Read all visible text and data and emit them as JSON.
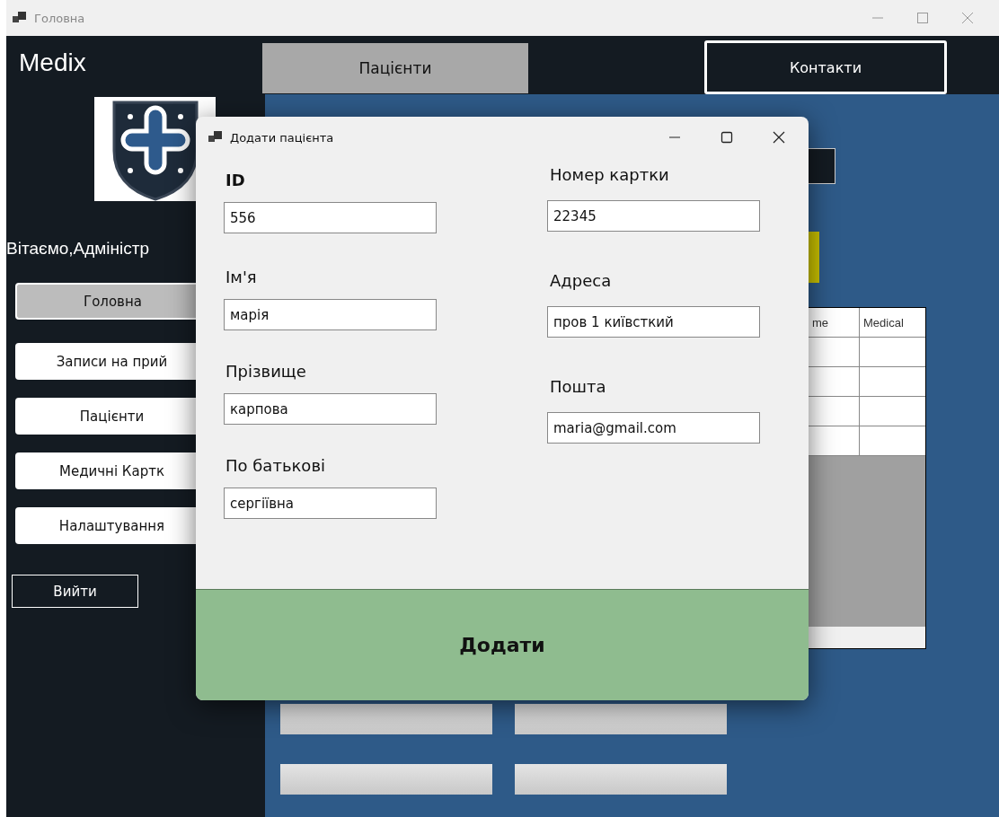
{
  "window": {
    "title": "Головна"
  },
  "app": {
    "brand": "Medix",
    "greeting": "Вітаємо,Адміністр"
  },
  "top_nav": [
    {
      "label": "Пацієнти",
      "selected": true
    },
    {
      "label": "Контакти",
      "selected": false
    }
  ],
  "sidebar": {
    "items": [
      {
        "label": "Головна",
        "selected": true
      },
      {
        "label": "Записи на прий",
        "selected": false
      },
      {
        "label": "Пацієнти",
        "selected": false
      },
      {
        "label": "Медичні Картк",
        "selected": false
      },
      {
        "label": "Налаштування",
        "selected": false
      }
    ],
    "logout": "Вийти"
  },
  "table": {
    "columns": [
      "me",
      "Medical"
    ]
  },
  "dialog": {
    "title": "Додати пацієнта",
    "left_fields": [
      {
        "label": "ID",
        "value": "556",
        "bold": true
      },
      {
        "label": "Ім'я",
        "value": "марія",
        "bold": false
      },
      {
        "label": "Прізвище",
        "value": "карпова",
        "bold": false
      },
      {
        "label": "По батькові",
        "value": "сергіївна",
        "bold": false
      }
    ],
    "right_fields": [
      {
        "label": "Номер картки",
        "value": "22345"
      },
      {
        "label": "Адреса",
        "value": "пров 1 київсткий"
      },
      {
        "label": "Пошта",
        "value": "maria@gmail.com"
      }
    ],
    "submit": "Додати"
  }
}
